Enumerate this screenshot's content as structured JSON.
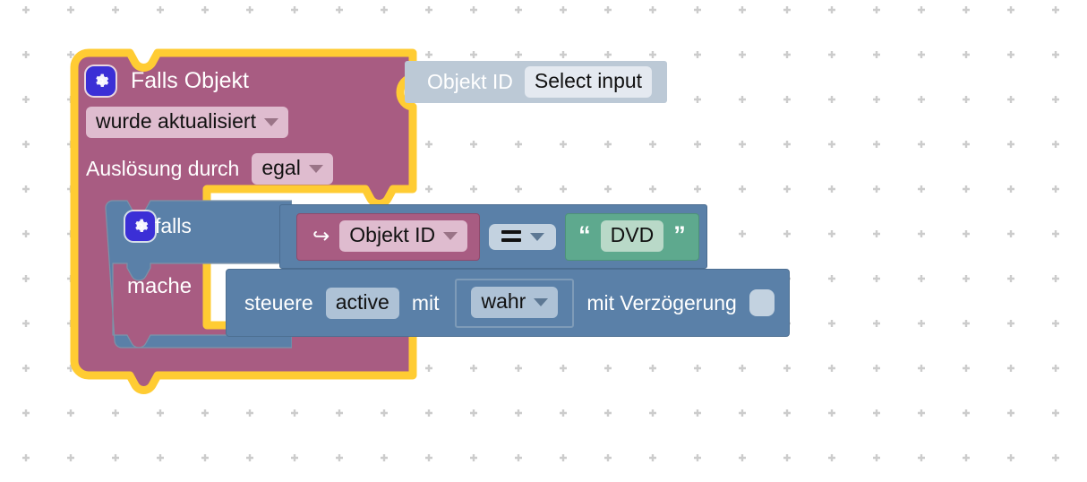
{
  "workspace": {
    "name": "blockly-workspace",
    "background_color": "#ffffff",
    "grid_dot_color": "#cccccc",
    "grid_spacing_px": 50
  },
  "palette": {
    "event_block": "#a85c82",
    "control_block": "#5a80a8",
    "value_block": "#bcc9d6",
    "text_block": "#5ea98e",
    "highlight": "#ffcc33",
    "mutator_icon": "#3b2fd6"
  },
  "blocks": {
    "event": {
      "name": "falls-objekt-event-block",
      "title": "Falls Objekt",
      "mutator_icon": "gear-icon",
      "trigger_dropdown": {
        "value": "wurde aktualisiert",
        "icon": "chevron-down-icon"
      },
      "cause_label": "Auslösung durch",
      "cause_dropdown": {
        "value": "egal",
        "icon": "chevron-down-icon"
      },
      "selected": true
    },
    "object_id_input": {
      "name": "objekt-id-value-block",
      "label": "Objekt ID",
      "field_value": "Select input"
    },
    "if_block": {
      "name": "falls-if-block",
      "mutator_icon": "gear-icon",
      "if_label": "falls",
      "do_label": "mache"
    },
    "comparison": {
      "name": "logic-compare-block",
      "variable": {
        "name": "objekt-id-variable-block",
        "icon": "arrow-hook-icon",
        "value": "Objekt ID",
        "dropdown_icon": "chevron-down-icon"
      },
      "operator": {
        "value": "=",
        "icon": "chevron-down-icon"
      },
      "string": {
        "name": "text-string-block",
        "open_quote": "“",
        "value": "DVD",
        "close_quote": "”"
      }
    },
    "control_statement": {
      "name": "steuere-statement-block",
      "verb_label": "steuere",
      "target_field": "active",
      "with_label": "mit",
      "boolean_value": {
        "value": "wahr",
        "icon": "chevron-down-icon"
      },
      "delay_label": "mit Verzögerung",
      "delay_checkbox": {
        "name": "delay-checkbox",
        "checked": false
      }
    }
  }
}
